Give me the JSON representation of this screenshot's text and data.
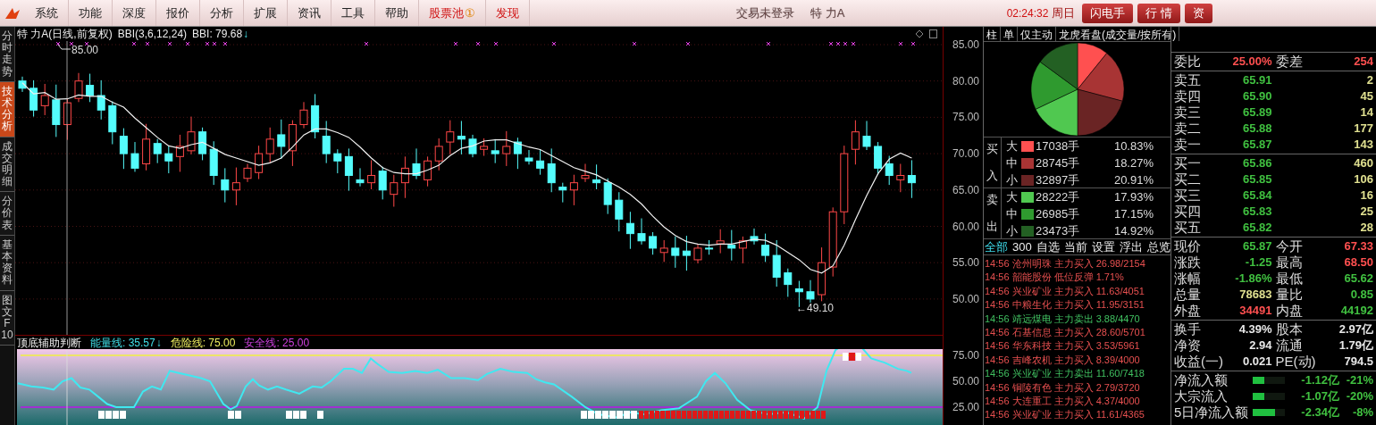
{
  "menu_bar": {
    "items": [
      {
        "label": "系统",
        "kind": "normal"
      },
      {
        "label": "功能",
        "kind": "normal"
      },
      {
        "label": "深度",
        "kind": "normal"
      },
      {
        "label": "报价",
        "kind": "normal"
      },
      {
        "label": "分析",
        "kind": "normal"
      },
      {
        "label": "扩展",
        "kind": "normal"
      },
      {
        "label": "资讯",
        "kind": "normal"
      },
      {
        "label": "工具",
        "kind": "normal"
      },
      {
        "label": "帮助",
        "kind": "normal"
      },
      {
        "label": "股票池",
        "kind": "highlight",
        "badge": "①"
      },
      {
        "label": "发现",
        "kind": "highlight"
      }
    ],
    "login_status": "交易未登录",
    "stock_name": "特 力A",
    "time": "02:24:32",
    "weekday": "周日",
    "buttons": [
      "闪电手",
      "行 情",
      "资"
    ]
  },
  "side_tabs": [
    {
      "label": "分时走势",
      "selected": false
    },
    {
      "label": "技术分析",
      "selected": true
    },
    {
      "label": "成交明细",
      "selected": false
    },
    {
      "label": "分价表",
      "selected": false
    },
    {
      "label": "基本资料",
      "selected": false
    },
    {
      "label": "图文F10",
      "selected": false
    }
  ],
  "chart": {
    "title": "特 力A(日线,前复权)",
    "indicator": "BBI(3,6,12,24)",
    "indicator_value": "BBI: 79.68",
    "trend_arrow": "↓",
    "high_label": "85.00",
    "low_label": "49.10",
    "low_arrow": "←",
    "yticks": [
      "85.00",
      "80.00",
      "75.00",
      "70.00",
      "65.00",
      "60.00",
      "55.00",
      "50.00"
    ]
  },
  "sub_chart": {
    "title": "顶底辅助判断",
    "trend_arrow": "↓",
    "legend": [
      {
        "label": "能量线: 35.57",
        "color": "#40e0e8"
      },
      {
        "label": "危险线: 75.00",
        "color": "#f0f060"
      },
      {
        "label": "安全线: 25.00",
        "color": "#d040e0"
      }
    ],
    "yticks": [
      "75.00",
      "50.00",
      "25.00"
    ]
  },
  "money_flow": {
    "tabs": [
      {
        "label": "柱",
        "selected": false
      },
      {
        "label": "单",
        "selected": false
      },
      {
        "label": "仅主动",
        "selected": false
      },
      {
        "label": "龙虎看盘(成交量/按所有)",
        "selected": false
      }
    ],
    "chart_data": {
      "type": "pie",
      "values": [
        10.83,
        18.27,
        20.91,
        17.93,
        17.15,
        14.92
      ]
    },
    "groups": [
      {
        "side": "买入",
        "rows": [
          {
            "size": "大",
            "color": "#ff5050",
            "volume": "17038手",
            "percent": "10.83%"
          },
          {
            "size": "中",
            "color": "#a83434",
            "volume": "28745手",
            "percent": "18.27%"
          },
          {
            "size": "小",
            "color": "#6a2424",
            "volume": "32897手",
            "percent": "20.91%"
          }
        ]
      },
      {
        "side": "卖出",
        "rows": [
          {
            "size": "大",
            "color": "#50c850",
            "volume": "28222手",
            "percent": "17.93%"
          },
          {
            "size": "中",
            "color": "#2f9a2f",
            "volume": "26985手",
            "percent": "17.15%"
          },
          {
            "size": "小",
            "color": "#236023",
            "volume": "23473手",
            "percent": "14.92%"
          }
        ]
      }
    ],
    "filters": [
      {
        "label": "全部",
        "selected": true
      },
      {
        "label": "300",
        "selected": false
      },
      {
        "label": "自选",
        "selected": false
      },
      {
        "label": "当前",
        "selected": false
      },
      {
        "label": "设置",
        "selected": false
      },
      {
        "label": "浮出",
        "selected": false
      },
      {
        "label": "总览",
        "selected": false
      }
    ],
    "alerts": [
      {
        "time": "14:56",
        "stock": "沧州明珠",
        "action": "主力买入",
        "detail": "26.98/2154",
        "kind": "rise"
      },
      {
        "time": "14:56",
        "stock": "韶能股份",
        "action": "低位反弹",
        "detail": "1.71%",
        "kind": "rise"
      },
      {
        "time": "14:56",
        "stock": "兴业矿业",
        "action": "主力买入",
        "detail": "11.63/4051",
        "kind": "rise"
      },
      {
        "time": "14:56",
        "stock": "中粮生化",
        "action": "主力买入",
        "detail": "11.95/3151",
        "kind": "rise"
      },
      {
        "time": "14:56",
        "stock": "靖远煤电",
        "action": "主力卖出",
        "detail": "3.88/4470",
        "kind": "fall"
      },
      {
        "time": "14:56",
        "stock": "石基信息",
        "action": "主力买入",
        "detail": "28.60/5701",
        "kind": "rise"
      },
      {
        "time": "14:56",
        "stock": "华东科技",
        "action": "主力买入",
        "detail": "3.53/5961",
        "kind": "rise"
      },
      {
        "time": "14:56",
        "stock": "吉峰农机",
        "action": "主力买入",
        "detail": "8.39/4000",
        "kind": "rise"
      },
      {
        "time": "14:56",
        "stock": "兴业矿业",
        "action": "主力卖出",
        "detail": "11.60/7418",
        "kind": "fall"
      },
      {
        "time": "14:56",
        "stock": "铜陵有色",
        "action": "主力买入",
        "detail": "2.79/3720",
        "kind": "rise"
      },
      {
        "time": "14:56",
        "stock": "大连重工",
        "action": "主力买入",
        "detail": "4.37/4000",
        "kind": "rise"
      },
      {
        "time": "14:56",
        "stock": "兴业矿业",
        "action": "主力买入",
        "detail": "11.61/4365",
        "kind": "rise"
      }
    ]
  },
  "quote": {
    "ratio": [
      {
        "label": "委比",
        "value": "25.00%"
      },
      {
        "label": "委差",
        "value": "254"
      }
    ],
    "asks": [
      {
        "label": "卖五",
        "price": "65.91",
        "volume": "2"
      },
      {
        "label": "卖四",
        "price": "65.90",
        "volume": "45"
      },
      {
        "label": "卖三",
        "price": "65.89",
        "volume": "14"
      },
      {
        "label": "卖二",
        "price": "65.88",
        "volume": "177"
      },
      {
        "label": "卖一",
        "price": "65.87",
        "volume": "143"
      }
    ],
    "bids": [
      {
        "label": "买一",
        "price": "65.86",
        "volume": "460"
      },
      {
        "label": "买二",
        "price": "65.85",
        "volume": "106"
      },
      {
        "label": "买三",
        "price": "65.84",
        "volume": "16"
      },
      {
        "label": "买四",
        "price": "65.83",
        "volume": "25"
      },
      {
        "label": "买五",
        "price": "65.82",
        "volume": "28"
      }
    ],
    "stats": [
      {
        "label": "现价",
        "value": "65.87",
        "color": "#40c040"
      },
      {
        "label": "今开",
        "value": "67.33",
        "color": "#ff5050"
      },
      {
        "label": "涨跌",
        "value": "-1.25",
        "color": "#40c040"
      },
      {
        "label": "最高",
        "value": "68.50",
        "color": "#ff5050"
      },
      {
        "label": "涨幅",
        "value": "-1.86%",
        "color": "#40c040"
      },
      {
        "label": "最低",
        "value": "65.62",
        "color": "#40c040"
      },
      {
        "label": "总量",
        "value": "78683",
        "color": "#e0e090"
      },
      {
        "label": "量比",
        "value": "0.85",
        "color": "#40c040"
      },
      {
        "label": "外盘",
        "value": "34491",
        "color": "#ff5050"
      },
      {
        "label": "内盘",
        "value": "44192",
        "color": "#40c040"
      }
    ],
    "fundamentals": [
      {
        "label": "换手",
        "value": "4.39%"
      },
      {
        "label": "股本",
        "value": "2.97亿"
      },
      {
        "label": "净资",
        "value": "2.94"
      },
      {
        "label": "流通",
        "value": "1.79亿"
      },
      {
        "label": "收益(一)",
        "value": "0.021"
      },
      {
        "label": "PE(动)",
        "value": "794.5"
      }
    ],
    "flows": [
      {
        "label": "净流入额",
        "level": 0.35,
        "amount": "-1.12亿",
        "percent": "-21%"
      },
      {
        "label": "大宗流入",
        "level": 0.35,
        "amount": "-1.07亿",
        "percent": "-20%"
      },
      {
        "label": "5日净流入额",
        "level": 0.7,
        "amount": "-2.34亿",
        "percent": "-8%"
      }
    ]
  }
}
